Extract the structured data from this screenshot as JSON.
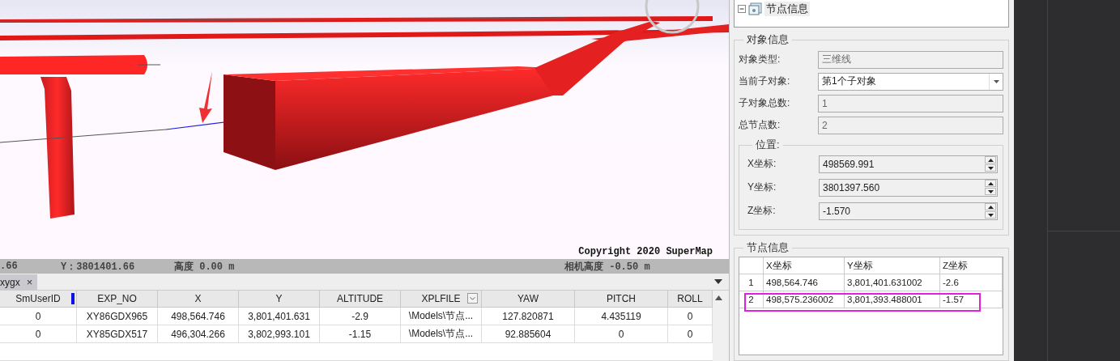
{
  "viewport": {
    "copyright": "Copyright 2020 SuperMap"
  },
  "status_bar": [
    ".66",
    "Y：3801401.66",
    "高度 0.00 m",
    "相机高度 -0.50 m"
  ],
  "tabs": [
    {
      "label": "xygx",
      "selected": true,
      "close": "×"
    }
  ],
  "table": {
    "columns": [
      {
        "label": "SmUserID",
        "marker": true,
        "filter": false
      },
      {
        "label": "EXP_NO",
        "marker": false,
        "filter": false
      },
      {
        "label": "X",
        "marker": false,
        "filter": false
      },
      {
        "label": "Y",
        "marker": false,
        "filter": false
      },
      {
        "label": "ALTITUDE",
        "marker": false,
        "filter": false
      },
      {
        "label": "XPLFILE",
        "marker": false,
        "filter": true
      },
      {
        "label": "YAW",
        "marker": false,
        "filter": false
      },
      {
        "label": "PITCH",
        "marker": false,
        "filter": false
      },
      {
        "label": "ROLL",
        "marker": false,
        "filter": false
      }
    ],
    "rows": [
      [
        "0",
        "XY86GDX965",
        "498,564.746",
        "3,801,401.631",
        "-2.9",
        "\\Models\\节点...",
        "127.820871",
        "4.435119",
        "0"
      ],
      [
        "0",
        "XY85GDX517",
        "496,304.266",
        "3,802,993.101",
        "-1.15",
        "\\Models\\节点...",
        "92.885604",
        "0",
        "0"
      ]
    ]
  },
  "tree": {
    "items": [
      {
        "label": "节点信息",
        "expanded": true
      }
    ]
  },
  "object_info": {
    "title": "对象信息",
    "fields": [
      {
        "label": "对象类型:",
        "value": "三维线",
        "kind": "text",
        "disabled": true
      },
      {
        "label": "当前子对象:",
        "value": "第1个子对象",
        "kind": "dropdown",
        "disabled": false
      },
      {
        "label": "子对象总数:",
        "value": "1",
        "kind": "text",
        "disabled": true
      },
      {
        "label": "总节点数:",
        "value": "2",
        "kind": "text",
        "disabled": true
      }
    ]
  },
  "position": {
    "title": "位置:",
    "fields": [
      {
        "label": "X坐标:",
        "value": "498569.991"
      },
      {
        "label": "Y坐标:",
        "value": "3801397.560"
      },
      {
        "label": "Z坐标:",
        "value": "-1.570"
      }
    ]
  },
  "node_info": {
    "title": "节点信息",
    "columns": [
      "X坐标",
      "Y坐标",
      "Z坐标"
    ],
    "rows": [
      {
        "index": "1",
        "cells": [
          "498,564.746",
          "3,801,401.631002",
          "-2.6"
        ],
        "highlighted": false
      },
      {
        "index": "2",
        "cells": [
          "498,575.236002",
          "3,801,393.488001",
          "-1.57"
        ],
        "highlighted": true
      }
    ]
  }
}
